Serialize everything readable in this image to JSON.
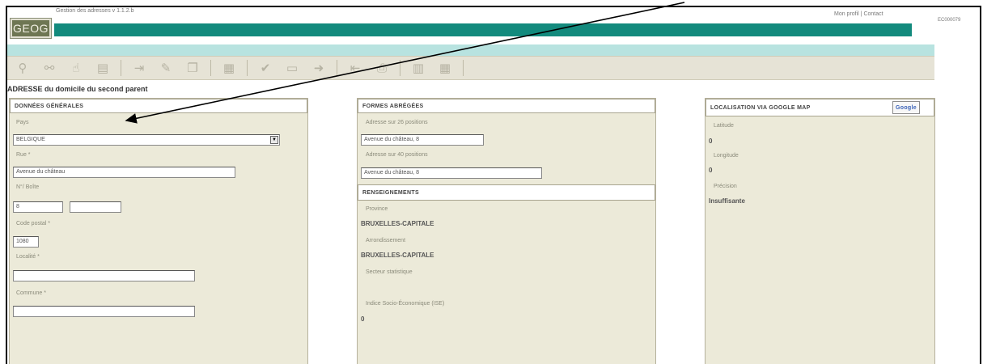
{
  "app": {
    "logo": "GEOG",
    "title": "Gestion des adresses v 1.1.2.b",
    "links": {
      "profile": "Mon profil",
      "separator": "|",
      "contact": "Contact"
    },
    "user_id": "EC000079"
  },
  "toolbar": {
    "buttons": [
      "find-icon",
      "zoom-icon",
      "hand-icon",
      "document-icon",
      "export-icon",
      "edit-icon",
      "copy-icon",
      "grid-icon",
      "check-icon",
      "screen-icon",
      "forward-icon",
      "import-icon",
      "print-icon",
      "book-icon",
      "table-icon"
    ]
  },
  "page_heading": "ADRESSE du domicile du second parent",
  "general": {
    "title": "DONNÉES GÉNÉRALES",
    "pays_label": "Pays",
    "pays_value": "BELGIQUE",
    "rue_label": "Rue *",
    "rue_value": "Avenue du château",
    "num_label": "N°/ Boîte",
    "num_value": "8",
    "boite_value": "",
    "cp_label": "Code postal *",
    "cp_value": "1080",
    "localite_label": "Localité *",
    "localite_value": "",
    "commune_label": "Commune *",
    "commune_value": ""
  },
  "forms": {
    "title": "FORMES ABRÉGÉES",
    "addr26_label": "Adresse sur 26 positions",
    "addr26_value": "Avenue du château, 8",
    "addr40_label": "Adresse sur 40 positions",
    "addr40_value": "Avenue du château, 8",
    "info_title": "RENSEIGNEMENTS",
    "province_label": "Province",
    "province_value": "BRUXELLES-CAPITALE",
    "arr_label": "Arrondissement",
    "arr_value": "BRUXELLES-CAPITALE",
    "secteur_label": "Secteur statistique",
    "ise_label": "Indice Socio-Économique (ISE)",
    "ise_value": "0"
  },
  "geo": {
    "title": "LOCALISATION VIA GOOGLE MAP",
    "google_label": "Google",
    "lat_label": "Latitude",
    "lat_value": "0",
    "lng_label": "Longitude",
    "lng_value": "0",
    "prec_label": "Précision",
    "prec_value": "Insuffisante"
  }
}
